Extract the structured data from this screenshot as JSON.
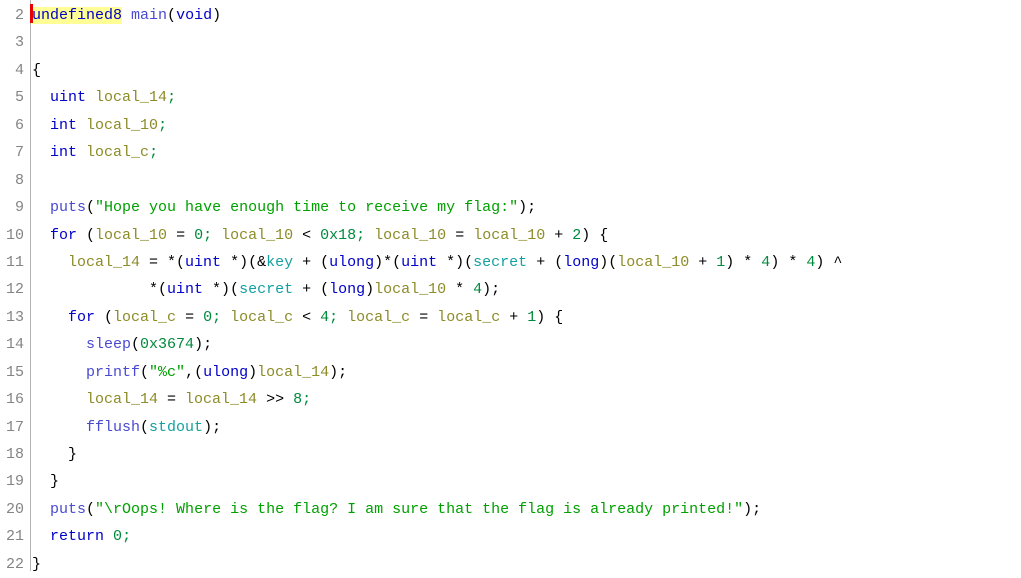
{
  "view": {
    "name": "ghidra-decompiler",
    "background_color": "#ffffff",
    "gutter_rule_color": "#b4b4b4",
    "line_number_color": "#848484",
    "highlight_color": "#ffff96",
    "caret_color": "#e60000"
  },
  "palette": {
    "keyword": "#0000c8",
    "function": "#4a4ad0",
    "local_variable": "#8c8c28",
    "global_symbol": "#14a0a0",
    "string": "#00a000",
    "number": "#008a3c",
    "punctuation": "#000000"
  },
  "code": {
    "first_line_number": 2,
    "last_line_number": 22,
    "lines": [
      {
        "number": "2",
        "caret": true,
        "tokens": [
          {
            "t": "undefined8",
            "c": "t-kw",
            "hl": true
          },
          {
            "t": " ",
            "c": "t-plain"
          },
          {
            "t": "main",
            "c": "t-fn"
          },
          {
            "t": "(",
            "c": "t-punct"
          },
          {
            "t": "void",
            "c": "t-kw"
          },
          {
            "t": ")",
            "c": "t-punct"
          }
        ]
      },
      {
        "number": "3",
        "tokens": []
      },
      {
        "number": "4",
        "tokens": [
          {
            "t": "{",
            "c": "t-punct"
          }
        ]
      },
      {
        "number": "5",
        "tokens": [
          {
            "t": "  ",
            "c": "t-plain"
          },
          {
            "t": "uint",
            "c": "t-kw"
          },
          {
            "t": " ",
            "c": "t-plain"
          },
          {
            "t": "local_14",
            "c": "t-local"
          },
          {
            "t": ";",
            "c": "t-num"
          }
        ]
      },
      {
        "number": "6",
        "tokens": [
          {
            "t": "  ",
            "c": "t-plain"
          },
          {
            "t": "int",
            "c": "t-kw"
          },
          {
            "t": " ",
            "c": "t-plain"
          },
          {
            "t": "local_10",
            "c": "t-local"
          },
          {
            "t": ";",
            "c": "t-num"
          }
        ]
      },
      {
        "number": "7",
        "tokens": [
          {
            "t": "  ",
            "c": "t-plain"
          },
          {
            "t": "int",
            "c": "t-kw"
          },
          {
            "t": " ",
            "c": "t-plain"
          },
          {
            "t": "local_c",
            "c": "t-local"
          },
          {
            "t": ";",
            "c": "t-num"
          }
        ]
      },
      {
        "number": "8",
        "tokens": []
      },
      {
        "number": "9",
        "tokens": [
          {
            "t": "  ",
            "c": "t-plain"
          },
          {
            "t": "puts",
            "c": "t-fn"
          },
          {
            "t": "(",
            "c": "t-punct"
          },
          {
            "t": "\"Hope you have enough time to receive my flag:\"",
            "c": "t-str"
          },
          {
            "t": ");",
            "c": "t-punct"
          }
        ]
      },
      {
        "number": "10",
        "tokens": [
          {
            "t": "  ",
            "c": "t-plain"
          },
          {
            "t": "for",
            "c": "t-kw"
          },
          {
            "t": " (",
            "c": "t-punct"
          },
          {
            "t": "local_10",
            "c": "t-local"
          },
          {
            "t": " = ",
            "c": "t-punct"
          },
          {
            "t": "0",
            "c": "t-num"
          },
          {
            "t": "; ",
            "c": "t-num"
          },
          {
            "t": "local_10",
            "c": "t-local"
          },
          {
            "t": " < ",
            "c": "t-punct"
          },
          {
            "t": "0x18",
            "c": "t-num"
          },
          {
            "t": "; ",
            "c": "t-num"
          },
          {
            "t": "local_10",
            "c": "t-local"
          },
          {
            "t": " = ",
            "c": "t-punct"
          },
          {
            "t": "local_10",
            "c": "t-local"
          },
          {
            "t": " + ",
            "c": "t-punct"
          },
          {
            "t": "2",
            "c": "t-num"
          },
          {
            "t": ") {",
            "c": "t-punct"
          }
        ]
      },
      {
        "number": "11",
        "tokens": [
          {
            "t": "    ",
            "c": "t-plain"
          },
          {
            "t": "local_14",
            "c": "t-local"
          },
          {
            "t": " = *(",
            "c": "t-punct"
          },
          {
            "t": "uint",
            "c": "t-type"
          },
          {
            "t": " *)(&",
            "c": "t-punct"
          },
          {
            "t": "key",
            "c": "t-global"
          },
          {
            "t": " + (",
            "c": "t-punct"
          },
          {
            "t": "ulong",
            "c": "t-type"
          },
          {
            "t": ")*(",
            "c": "t-punct"
          },
          {
            "t": "uint",
            "c": "t-type"
          },
          {
            "t": " *)(",
            "c": "t-punct"
          },
          {
            "t": "secret",
            "c": "t-global"
          },
          {
            "t": " + (",
            "c": "t-punct"
          },
          {
            "t": "long",
            "c": "t-type"
          },
          {
            "t": ")(",
            "c": "t-punct"
          },
          {
            "t": "local_10",
            "c": "t-local"
          },
          {
            "t": " + ",
            "c": "t-punct"
          },
          {
            "t": "1",
            "c": "t-num"
          },
          {
            "t": ") * ",
            "c": "t-punct"
          },
          {
            "t": "4",
            "c": "t-num"
          },
          {
            "t": ") * ",
            "c": "t-punct"
          },
          {
            "t": "4",
            "c": "t-num"
          },
          {
            "t": ") ^",
            "c": "t-punct"
          }
        ]
      },
      {
        "number": "12",
        "tokens": [
          {
            "t": "             *(",
            "c": "t-punct"
          },
          {
            "t": "uint",
            "c": "t-type"
          },
          {
            "t": " *)(",
            "c": "t-punct"
          },
          {
            "t": "secret",
            "c": "t-global"
          },
          {
            "t": " + (",
            "c": "t-punct"
          },
          {
            "t": "long",
            "c": "t-type"
          },
          {
            "t": ")",
            "c": "t-punct"
          },
          {
            "t": "local_10",
            "c": "t-local"
          },
          {
            "t": " * ",
            "c": "t-punct"
          },
          {
            "t": "4",
            "c": "t-num"
          },
          {
            "t": ");",
            "c": "t-punct"
          }
        ]
      },
      {
        "number": "13",
        "tokens": [
          {
            "t": "    ",
            "c": "t-plain"
          },
          {
            "t": "for",
            "c": "t-kw"
          },
          {
            "t": " (",
            "c": "t-punct"
          },
          {
            "t": "local_c",
            "c": "t-local"
          },
          {
            "t": " = ",
            "c": "t-punct"
          },
          {
            "t": "0",
            "c": "t-num"
          },
          {
            "t": "; ",
            "c": "t-num"
          },
          {
            "t": "local_c",
            "c": "t-local"
          },
          {
            "t": " < ",
            "c": "t-punct"
          },
          {
            "t": "4",
            "c": "t-num"
          },
          {
            "t": "; ",
            "c": "t-num"
          },
          {
            "t": "local_c",
            "c": "t-local"
          },
          {
            "t": " = ",
            "c": "t-punct"
          },
          {
            "t": "local_c",
            "c": "t-local"
          },
          {
            "t": " + ",
            "c": "t-punct"
          },
          {
            "t": "1",
            "c": "t-num"
          },
          {
            "t": ") {",
            "c": "t-punct"
          }
        ]
      },
      {
        "number": "14",
        "tokens": [
          {
            "t": "      ",
            "c": "t-plain"
          },
          {
            "t": "sleep",
            "c": "t-fn"
          },
          {
            "t": "(",
            "c": "t-punct"
          },
          {
            "t": "0x3674",
            "c": "t-num"
          },
          {
            "t": ");",
            "c": "t-punct"
          }
        ]
      },
      {
        "number": "15",
        "tokens": [
          {
            "t": "      ",
            "c": "t-plain"
          },
          {
            "t": "printf",
            "c": "t-fn"
          },
          {
            "t": "(",
            "c": "t-punct"
          },
          {
            "t": "\"%c\"",
            "c": "t-str"
          },
          {
            "t": ",(",
            "c": "t-punct"
          },
          {
            "t": "ulong",
            "c": "t-type"
          },
          {
            "t": ")",
            "c": "t-punct"
          },
          {
            "t": "local_14",
            "c": "t-local"
          },
          {
            "t": ");",
            "c": "t-punct"
          }
        ]
      },
      {
        "number": "16",
        "tokens": [
          {
            "t": "      ",
            "c": "t-plain"
          },
          {
            "t": "local_14",
            "c": "t-local"
          },
          {
            "t": " = ",
            "c": "t-punct"
          },
          {
            "t": "local_14",
            "c": "t-local"
          },
          {
            "t": " >> ",
            "c": "t-punct"
          },
          {
            "t": "8",
            "c": "t-num"
          },
          {
            "t": ";",
            "c": "t-num"
          }
        ]
      },
      {
        "number": "17",
        "tokens": [
          {
            "t": "      ",
            "c": "t-plain"
          },
          {
            "t": "fflush",
            "c": "t-fn"
          },
          {
            "t": "(",
            "c": "t-punct"
          },
          {
            "t": "stdout",
            "c": "t-global"
          },
          {
            "t": ");",
            "c": "t-punct"
          }
        ]
      },
      {
        "number": "18",
        "tokens": [
          {
            "t": "    }",
            "c": "t-punct"
          }
        ]
      },
      {
        "number": "19",
        "tokens": [
          {
            "t": "  }",
            "c": "t-punct"
          }
        ]
      },
      {
        "number": "20",
        "tokens": [
          {
            "t": "  ",
            "c": "t-plain"
          },
          {
            "t": "puts",
            "c": "t-fn"
          },
          {
            "t": "(",
            "c": "t-punct"
          },
          {
            "t": "\"\\rOops! Where is the flag? I am sure that the flag is already printed!\"",
            "c": "t-str"
          },
          {
            "t": ");",
            "c": "t-punct"
          }
        ]
      },
      {
        "number": "21",
        "tokens": [
          {
            "t": "  ",
            "c": "t-plain"
          },
          {
            "t": "return",
            "c": "t-kw"
          },
          {
            "t": " ",
            "c": "t-plain"
          },
          {
            "t": "0",
            "c": "t-num"
          },
          {
            "t": ";",
            "c": "t-num"
          }
        ]
      },
      {
        "number": "22",
        "tokens": [
          {
            "t": "}",
            "c": "t-punct"
          }
        ]
      }
    ]
  }
}
